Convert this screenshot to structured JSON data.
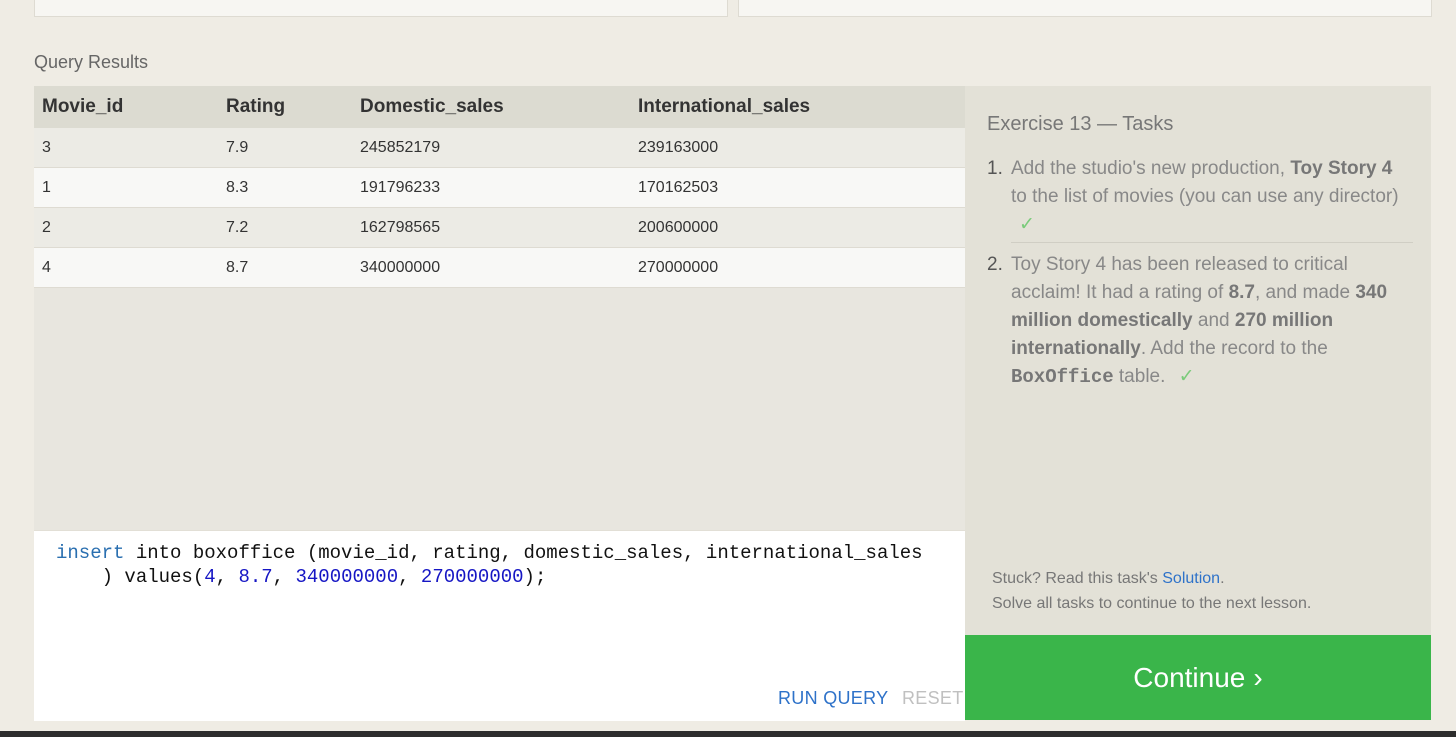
{
  "results": {
    "label": "Query Results",
    "columns": [
      "Movie_id",
      "Rating",
      "Domestic_sales",
      "International_sales"
    ],
    "rows": [
      [
        "3",
        "7.9",
        "245852179",
        "239163000"
      ],
      [
        "1",
        "8.3",
        "191796233",
        "170162503"
      ],
      [
        "2",
        "7.2",
        "162798565",
        "200600000"
      ],
      [
        "4",
        "8.7",
        "340000000",
        "270000000"
      ]
    ]
  },
  "editor": {
    "line1": {
      "kw": "insert",
      "rest": " into boxoffice (movie_id, rating, domestic_sales, international_sales"
    },
    "line2": {
      "pre": "    ) values(",
      "n1": "4",
      "c1": ", ",
      "n2": "8.7",
      "c2": ", ",
      "n3": "340000000",
      "c3": ", ",
      "n4": "270000000",
      "post": ");"
    },
    "run_label": "RUN QUERY",
    "reset_label": "RESET"
  },
  "tasks": {
    "title": "Exercise 13 — Tasks",
    "task1": {
      "num": "1.",
      "t1": "Add the studio's new production, ",
      "b1": "Toy Story 4",
      "t2": " to the list of movies (you can use any director)",
      "check": "✓"
    },
    "task2": {
      "num": "2.",
      "t1": "Toy Story 4 has been released to critical acclaim! It had a rating of ",
      "b1": "8.7",
      "t2": ", and made ",
      "b2": "340 million domestically",
      "t3": " and ",
      "b3": "270 million internationally",
      "t4": ". Add the record to the ",
      "code": "BoxOffice",
      "t5": " table.",
      "check": "✓"
    },
    "help_prefix": "Stuck? Read this task's ",
    "help_link": "Solution",
    "help_suffix": ".",
    "help_line2": "Solve all tasks to continue to the next lesson."
  },
  "continue": {
    "label": "Continue",
    "chevron": "›"
  },
  "colors": {
    "accent": "#3ab54a",
    "link": "#2e72c9",
    "check": "#7acb7a"
  }
}
